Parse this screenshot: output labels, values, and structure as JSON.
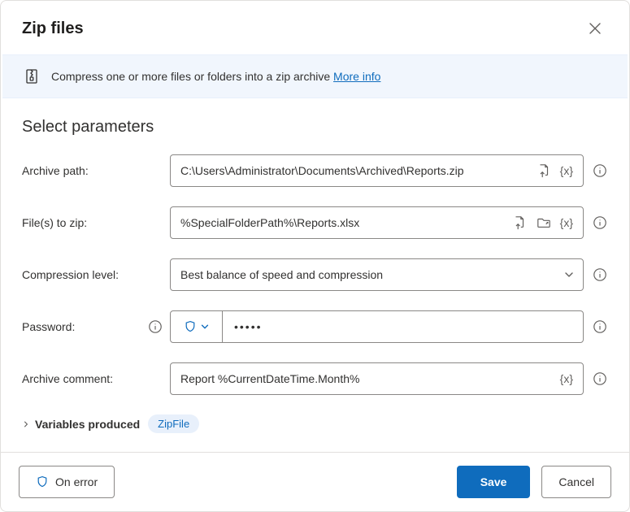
{
  "title": "Zip files",
  "banner": {
    "text": "Compress one or more files or folders into a zip archive ",
    "link": "More info"
  },
  "section": "Select parameters",
  "labels": {
    "archivePath": "Archive path:",
    "filesToZip": "File(s) to zip:",
    "compression": "Compression level:",
    "password": "Password:",
    "comment": "Archive comment:"
  },
  "values": {
    "archivePath": "C:\\Users\\Administrator\\Documents\\Archived\\Reports.zip",
    "filesToZip": "%SpecialFolderPath%\\Reports.xlsx",
    "compression": "Best balance of speed and compression",
    "password": "•••••",
    "comment": "Report %CurrentDateTime.Month%"
  },
  "variables": {
    "label": "Variables produced",
    "chip": "ZipFile"
  },
  "footer": {
    "onError": "On error",
    "save": "Save",
    "cancel": "Cancel"
  },
  "varToken": "{x}"
}
